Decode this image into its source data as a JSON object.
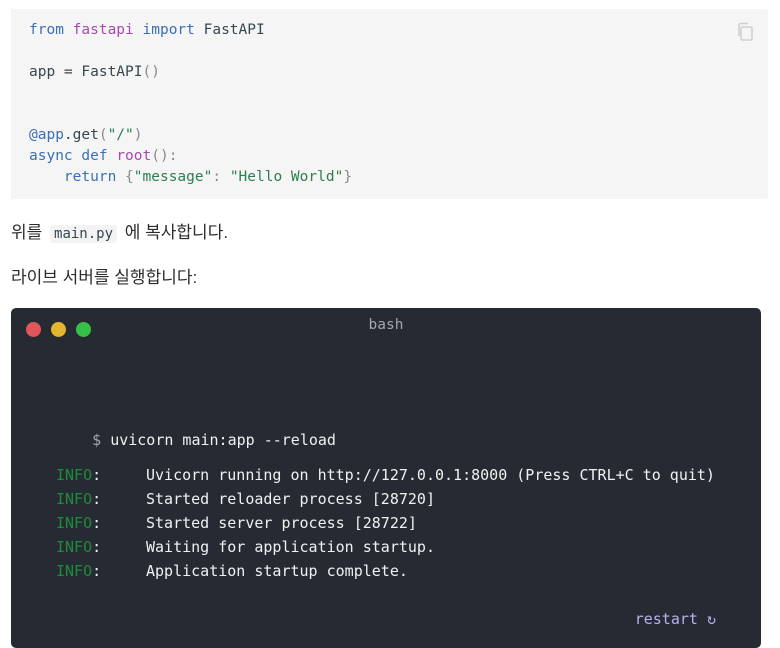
{
  "code_block": {
    "lines": [
      [
        {
          "t": "from",
          "c": "kw"
        },
        {
          "t": " "
        },
        {
          "t": "fastapi",
          "c": "mod"
        },
        {
          "t": " "
        },
        {
          "t": "import",
          "c": "kw"
        },
        {
          "t": " FastAPI"
        }
      ],
      [],
      [
        {
          "t": "app = FastAPI"
        },
        {
          "t": "()",
          "c": "punc"
        }
      ],
      [],
      [],
      [
        {
          "t": "@app",
          "c": "deco"
        },
        {
          "t": ".get"
        },
        {
          "t": "(",
          "c": "punc"
        },
        {
          "t": "\"/\"",
          "c": "str"
        },
        {
          "t": ")",
          "c": "punc"
        }
      ],
      [
        {
          "t": "async",
          "c": "kw"
        },
        {
          "t": " "
        },
        {
          "t": "def",
          "c": "kw"
        },
        {
          "t": " "
        },
        {
          "t": "root",
          "c": "fn"
        },
        {
          "t": "():",
          "c": "punc"
        }
      ],
      [
        {
          "t": "    "
        },
        {
          "t": "return",
          "c": "kw"
        },
        {
          "t": " "
        },
        {
          "t": "{",
          "c": "punc"
        },
        {
          "t": "\"message\"",
          "c": "str"
        },
        {
          "t": ": ",
          "c": "punc"
        },
        {
          "t": "\"Hello World\"",
          "c": "str"
        },
        {
          "t": "}",
          "c": "punc"
        }
      ]
    ],
    "copy_icon": "copy-icon"
  },
  "paragraph1": {
    "before": "위를",
    "code": "main.py",
    "after": "에 복사합니다."
  },
  "paragraph2": "라이브 서버를 실행합니다:",
  "terminal": {
    "title": "bash",
    "prompt": "$",
    "command": "uvicorn main:app --reload",
    "logs": [
      {
        "level": "INFO",
        "message": "Uvicorn running on http://127.0.0.1:8000 (Press CTRL+C to quit)"
      },
      {
        "level": "INFO",
        "message": "Started reloader process [28720]"
      },
      {
        "level": "INFO",
        "message": "Started server process [28722]"
      },
      {
        "level": "INFO",
        "message": "Waiting for application startup."
      },
      {
        "level": "INFO",
        "message": "Application startup complete."
      }
    ],
    "restart_label": "restart ↻",
    "colors": {
      "red": "#e0565b",
      "yellow": "#e4b52f",
      "green": "#36c047",
      "info": "#1f8a3b"
    }
  }
}
